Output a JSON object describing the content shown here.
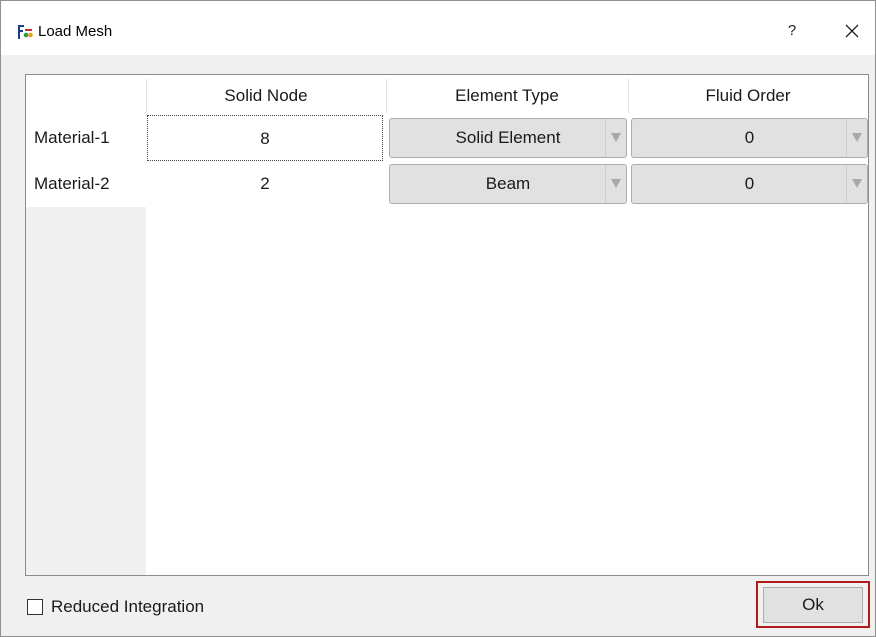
{
  "window": {
    "title": "Load Mesh",
    "help_label": "?",
    "icon_name": "fsi-app-icon",
    "icon_text": "FSI"
  },
  "table": {
    "columns": [
      "Solid Node",
      "Element Type",
      "Fluid Order"
    ],
    "rows": [
      {
        "header": "Material-1",
        "solid_node": "8",
        "element_type": "Solid Element",
        "fluid_order": "0"
      },
      {
        "header": "Material-2",
        "solid_node": "2",
        "element_type": "Beam",
        "fluid_order": "0"
      }
    ]
  },
  "footer": {
    "reduced_integration_label": "Reduced Integration",
    "reduced_integration_checked": false,
    "ok_label": "Ok"
  },
  "colors": {
    "highlight": "#b01a1a",
    "button_face": "#e1e1e1"
  }
}
